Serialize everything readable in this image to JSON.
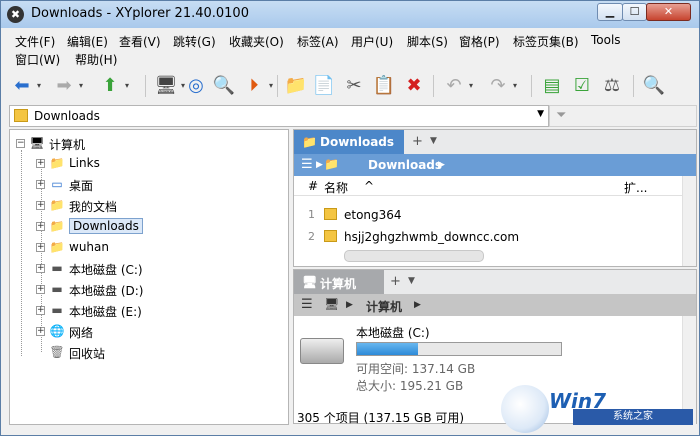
{
  "window": {
    "title": "Downloads - XYplorer 21.40.0100",
    "app_icon": "✖",
    "minimize": "▁",
    "maximize": "☐",
    "close": "✕"
  },
  "menu": [
    "文件(F)",
    "编辑(E)",
    "查看(V)",
    "跳转(G)",
    "收藏夹(O)",
    "标签(A)",
    "用户(U)",
    "脚本(S)",
    "窗格(P)",
    "标签页集(B)",
    "Tools",
    "窗口(W)",
    "帮助(H)"
  ],
  "address": {
    "path": "Downloads"
  },
  "tree": {
    "root": "计算机",
    "items": [
      "Links",
      "桌面",
      "我的文档",
      "Downloads",
      "wuhan",
      "本地磁盘 (C:)",
      "本地磁盘 (D:)",
      "本地磁盘 (E:)",
      "网络",
      "回收站"
    ]
  },
  "pane1": {
    "tab_label": "Downloads",
    "tab_add": "+",
    "breadcrumb": "Downloads",
    "columns": {
      "hash": "#",
      "name": "名称",
      "sort": "^",
      "ext": "扩..."
    },
    "rows": [
      {
        "num": "1",
        "name": "etong364"
      },
      {
        "num": "2",
        "name": "hsjj2ghgzhwmb_downcc.com"
      }
    ]
  },
  "pane2": {
    "tab_label": "计算机",
    "tab_add": "+",
    "breadcrumb": "计算机",
    "drive": {
      "name": "本地磁盘 (C:)",
      "free": "可用空间: 137.14 GB",
      "total": "总大小: 195.21 GB",
      "used_fraction": 0.3
    }
  },
  "status": {
    "text": "305 个项目 (137.15 GB 可用)"
  },
  "watermark": {
    "brand": "Win7",
    "label": "系统之家"
  }
}
